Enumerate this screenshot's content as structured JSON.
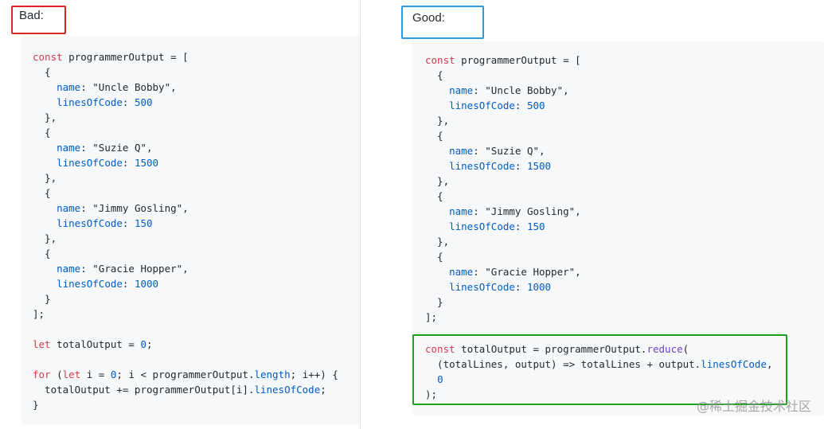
{
  "bad": {
    "label": "Bad:",
    "box_color": "#e02424",
    "code": [
      [
        [
          "kw",
          "const"
        ],
        [
          "t",
          " programmerOutput = ["
        ]
      ],
      [
        [
          "t",
          "  {"
        ]
      ],
      [
        [
          "t",
          "    "
        ],
        [
          "prop",
          "name"
        ],
        [
          "t",
          ": \"Uncle Bobby\","
        ]
      ],
      [
        [
          "t",
          "    "
        ],
        [
          "prop",
          "linesOfCode"
        ],
        [
          "t",
          ": "
        ],
        [
          "num",
          "500"
        ]
      ],
      [
        [
          "t",
          "  },"
        ]
      ],
      [
        [
          "t",
          "  {"
        ]
      ],
      [
        [
          "t",
          "    "
        ],
        [
          "prop",
          "name"
        ],
        [
          "t",
          ": \"Suzie Q\","
        ]
      ],
      [
        [
          "t",
          "    "
        ],
        [
          "prop",
          "linesOfCode"
        ],
        [
          "t",
          ": "
        ],
        [
          "num",
          "1500"
        ]
      ],
      [
        [
          "t",
          "  },"
        ]
      ],
      [
        [
          "t",
          "  {"
        ]
      ],
      [
        [
          "t",
          "    "
        ],
        [
          "prop",
          "name"
        ],
        [
          "t",
          ": \"Jimmy Gosling\","
        ]
      ],
      [
        [
          "t",
          "    "
        ],
        [
          "prop",
          "linesOfCode"
        ],
        [
          "t",
          ": "
        ],
        [
          "num",
          "150"
        ]
      ],
      [
        [
          "t",
          "  },"
        ]
      ],
      [
        [
          "t",
          "  {"
        ]
      ],
      [
        [
          "t",
          "    "
        ],
        [
          "prop",
          "name"
        ],
        [
          "t",
          ": \"Gracie Hopper\","
        ]
      ],
      [
        [
          "t",
          "    "
        ],
        [
          "prop",
          "linesOfCode"
        ],
        [
          "t",
          ": "
        ],
        [
          "num",
          "1000"
        ]
      ],
      [
        [
          "t",
          "  }"
        ]
      ],
      [
        [
          "t",
          "];"
        ]
      ],
      [
        [
          "t",
          ""
        ]
      ],
      [
        [
          "kw",
          "let"
        ],
        [
          "t",
          " totalOutput = "
        ],
        [
          "num",
          "0"
        ],
        [
          "t",
          ";"
        ]
      ],
      [
        [
          "t",
          ""
        ]
      ],
      [
        [
          "kw",
          "for"
        ],
        [
          "t",
          " ("
        ],
        [
          "kw",
          "let"
        ],
        [
          "t",
          " i = "
        ],
        [
          "num",
          "0"
        ],
        [
          "t",
          "; i < programmerOutput."
        ],
        [
          "prop",
          "length"
        ],
        [
          "t",
          "; i++) {"
        ]
      ],
      [
        [
          "t",
          "  totalOutput += programmerOutput[i]."
        ],
        [
          "prop",
          "linesOfCode"
        ],
        [
          "t",
          ";"
        ]
      ],
      [
        [
          "t",
          "}"
        ]
      ]
    ]
  },
  "good": {
    "label": "Good:",
    "box_color": "#2f9be4",
    "highlight_color": "#1aa320",
    "code": [
      [
        [
          "kw",
          "const"
        ],
        [
          "t",
          " programmerOutput = ["
        ]
      ],
      [
        [
          "t",
          "  {"
        ]
      ],
      [
        [
          "t",
          "    "
        ],
        [
          "prop",
          "name"
        ],
        [
          "t",
          ": \"Uncle Bobby\","
        ]
      ],
      [
        [
          "t",
          "    "
        ],
        [
          "prop",
          "linesOfCode"
        ],
        [
          "t",
          ": "
        ],
        [
          "num",
          "500"
        ]
      ],
      [
        [
          "t",
          "  },"
        ]
      ],
      [
        [
          "t",
          "  {"
        ]
      ],
      [
        [
          "t",
          "    "
        ],
        [
          "prop",
          "name"
        ],
        [
          "t",
          ": \"Suzie Q\","
        ]
      ],
      [
        [
          "t",
          "    "
        ],
        [
          "prop",
          "linesOfCode"
        ],
        [
          "t",
          ": "
        ],
        [
          "num",
          "1500"
        ]
      ],
      [
        [
          "t",
          "  },"
        ]
      ],
      [
        [
          "t",
          "  {"
        ]
      ],
      [
        [
          "t",
          "    "
        ],
        [
          "prop",
          "name"
        ],
        [
          "t",
          ": \"Jimmy Gosling\","
        ]
      ],
      [
        [
          "t",
          "    "
        ],
        [
          "prop",
          "linesOfCode"
        ],
        [
          "t",
          ": "
        ],
        [
          "num",
          "150"
        ]
      ],
      [
        [
          "t",
          "  },"
        ]
      ],
      [
        [
          "t",
          "  {"
        ]
      ],
      [
        [
          "t",
          "    "
        ],
        [
          "prop",
          "name"
        ],
        [
          "t",
          ": \"Gracie Hopper\","
        ]
      ],
      [
        [
          "t",
          "    "
        ],
        [
          "prop",
          "linesOfCode"
        ],
        [
          "t",
          ": "
        ],
        [
          "num",
          "1000"
        ]
      ],
      [
        [
          "t",
          "  }"
        ]
      ],
      [
        [
          "t",
          "];"
        ]
      ]
    ],
    "highlighted_code": [
      [
        [
          "kw",
          "const"
        ],
        [
          "t",
          " totalOutput = programmerOutput."
        ],
        [
          "fn",
          "reduce"
        ],
        [
          "t",
          "("
        ]
      ],
      [
        [
          "t",
          "  (totalLines, output) => totalLines + output."
        ],
        [
          "prop",
          "linesOfCode"
        ],
        [
          "t",
          ","
        ]
      ],
      [
        [
          "t",
          "  "
        ],
        [
          "num",
          "0"
        ]
      ],
      [
        [
          "t",
          ");"
        ]
      ]
    ]
  },
  "watermark": "@稀土掘金技术社区"
}
